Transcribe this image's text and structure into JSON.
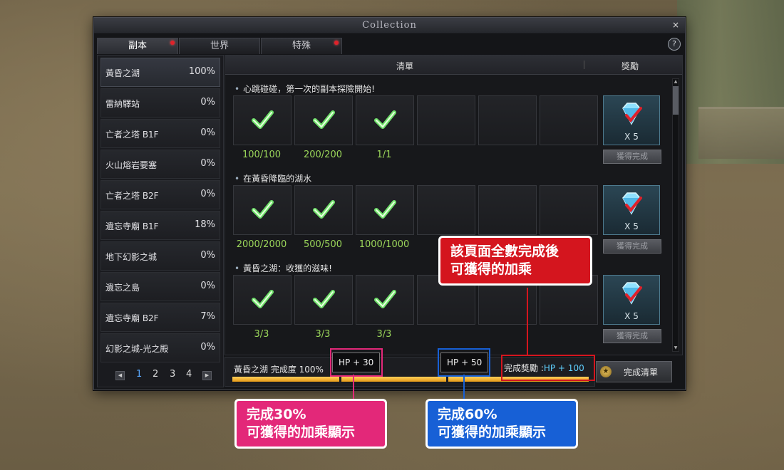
{
  "window": {
    "title": "Collection",
    "close_label": "×",
    "help_label": "?"
  },
  "tabs": [
    {
      "label": "副本",
      "badge": true
    },
    {
      "label": "世界",
      "badge": false
    },
    {
      "label": "特殊",
      "badge": true
    }
  ],
  "dungeons": [
    {
      "name": "黃昏之湖",
      "percent": "100%"
    },
    {
      "name": "雷納驛站",
      "percent": "0%"
    },
    {
      "name": "亡者之塔 B1F",
      "percent": "0%"
    },
    {
      "name": "火山熔岩要塞",
      "percent": "0%"
    },
    {
      "name": "亡者之塔 B2F",
      "percent": "0%"
    },
    {
      "name": "遺忘寺廟 B1F",
      "percent": "18%"
    },
    {
      "name": "地下幻影之城",
      "percent": "0%"
    },
    {
      "name": "遺忘之島",
      "percent": "0%"
    },
    {
      "name": "遺忘寺廟 B2F",
      "percent": "7%"
    },
    {
      "name": "幻影之城-光之殿",
      "percent": "0%"
    }
  ],
  "pager": {
    "prev": "◀",
    "next": "▶",
    "pages": [
      "1",
      "2",
      "3",
      "4"
    ],
    "current": "1"
  },
  "columns": {
    "list": "清單",
    "reward": "獎勵"
  },
  "sections": [
    {
      "title": "心跳碰碰，第一次的副本探險開始!",
      "counts": [
        "100/100",
        "200/200",
        "1/1"
      ],
      "reward_qty": "X 5",
      "claim_label": "獲得完成"
    },
    {
      "title": "在黃昏降臨的湖水",
      "counts": [
        "2000/2000",
        "500/500",
        "1000/1000"
      ],
      "reward_qty": "X 5",
      "claim_label": "獲得完成"
    },
    {
      "title": "黃昏之湖：收獲的滋味!",
      "counts": [
        "3/3",
        "3/3",
        "3/3"
      ],
      "reward_qty": "X 5",
      "claim_label": "獲得完成"
    }
  ],
  "bottom": {
    "completion_label": "黃昏之湖 完成度 100%",
    "progress": 1.0,
    "milestone_30": "HP + 30",
    "milestone_60": "HP + 50",
    "final_reward_label": "完成獎勵 :",
    "final_reward_value": "HP + 100",
    "complete_button": "完成清單"
  },
  "annotations": {
    "red": "該頁面全數完成後\n可獲得的加乘",
    "pink": "完成30%\n可獲得的加乘顯示",
    "blue": "完成60%\n可獲得的加乘顯示"
  },
  "colors": {
    "annotation_red": "#d4151e",
    "annotation_pink": "#e32879",
    "annotation_blue": "#1760d6",
    "count_green": "#9bd65a",
    "reward_cyan": "#5fd0ff"
  }
}
